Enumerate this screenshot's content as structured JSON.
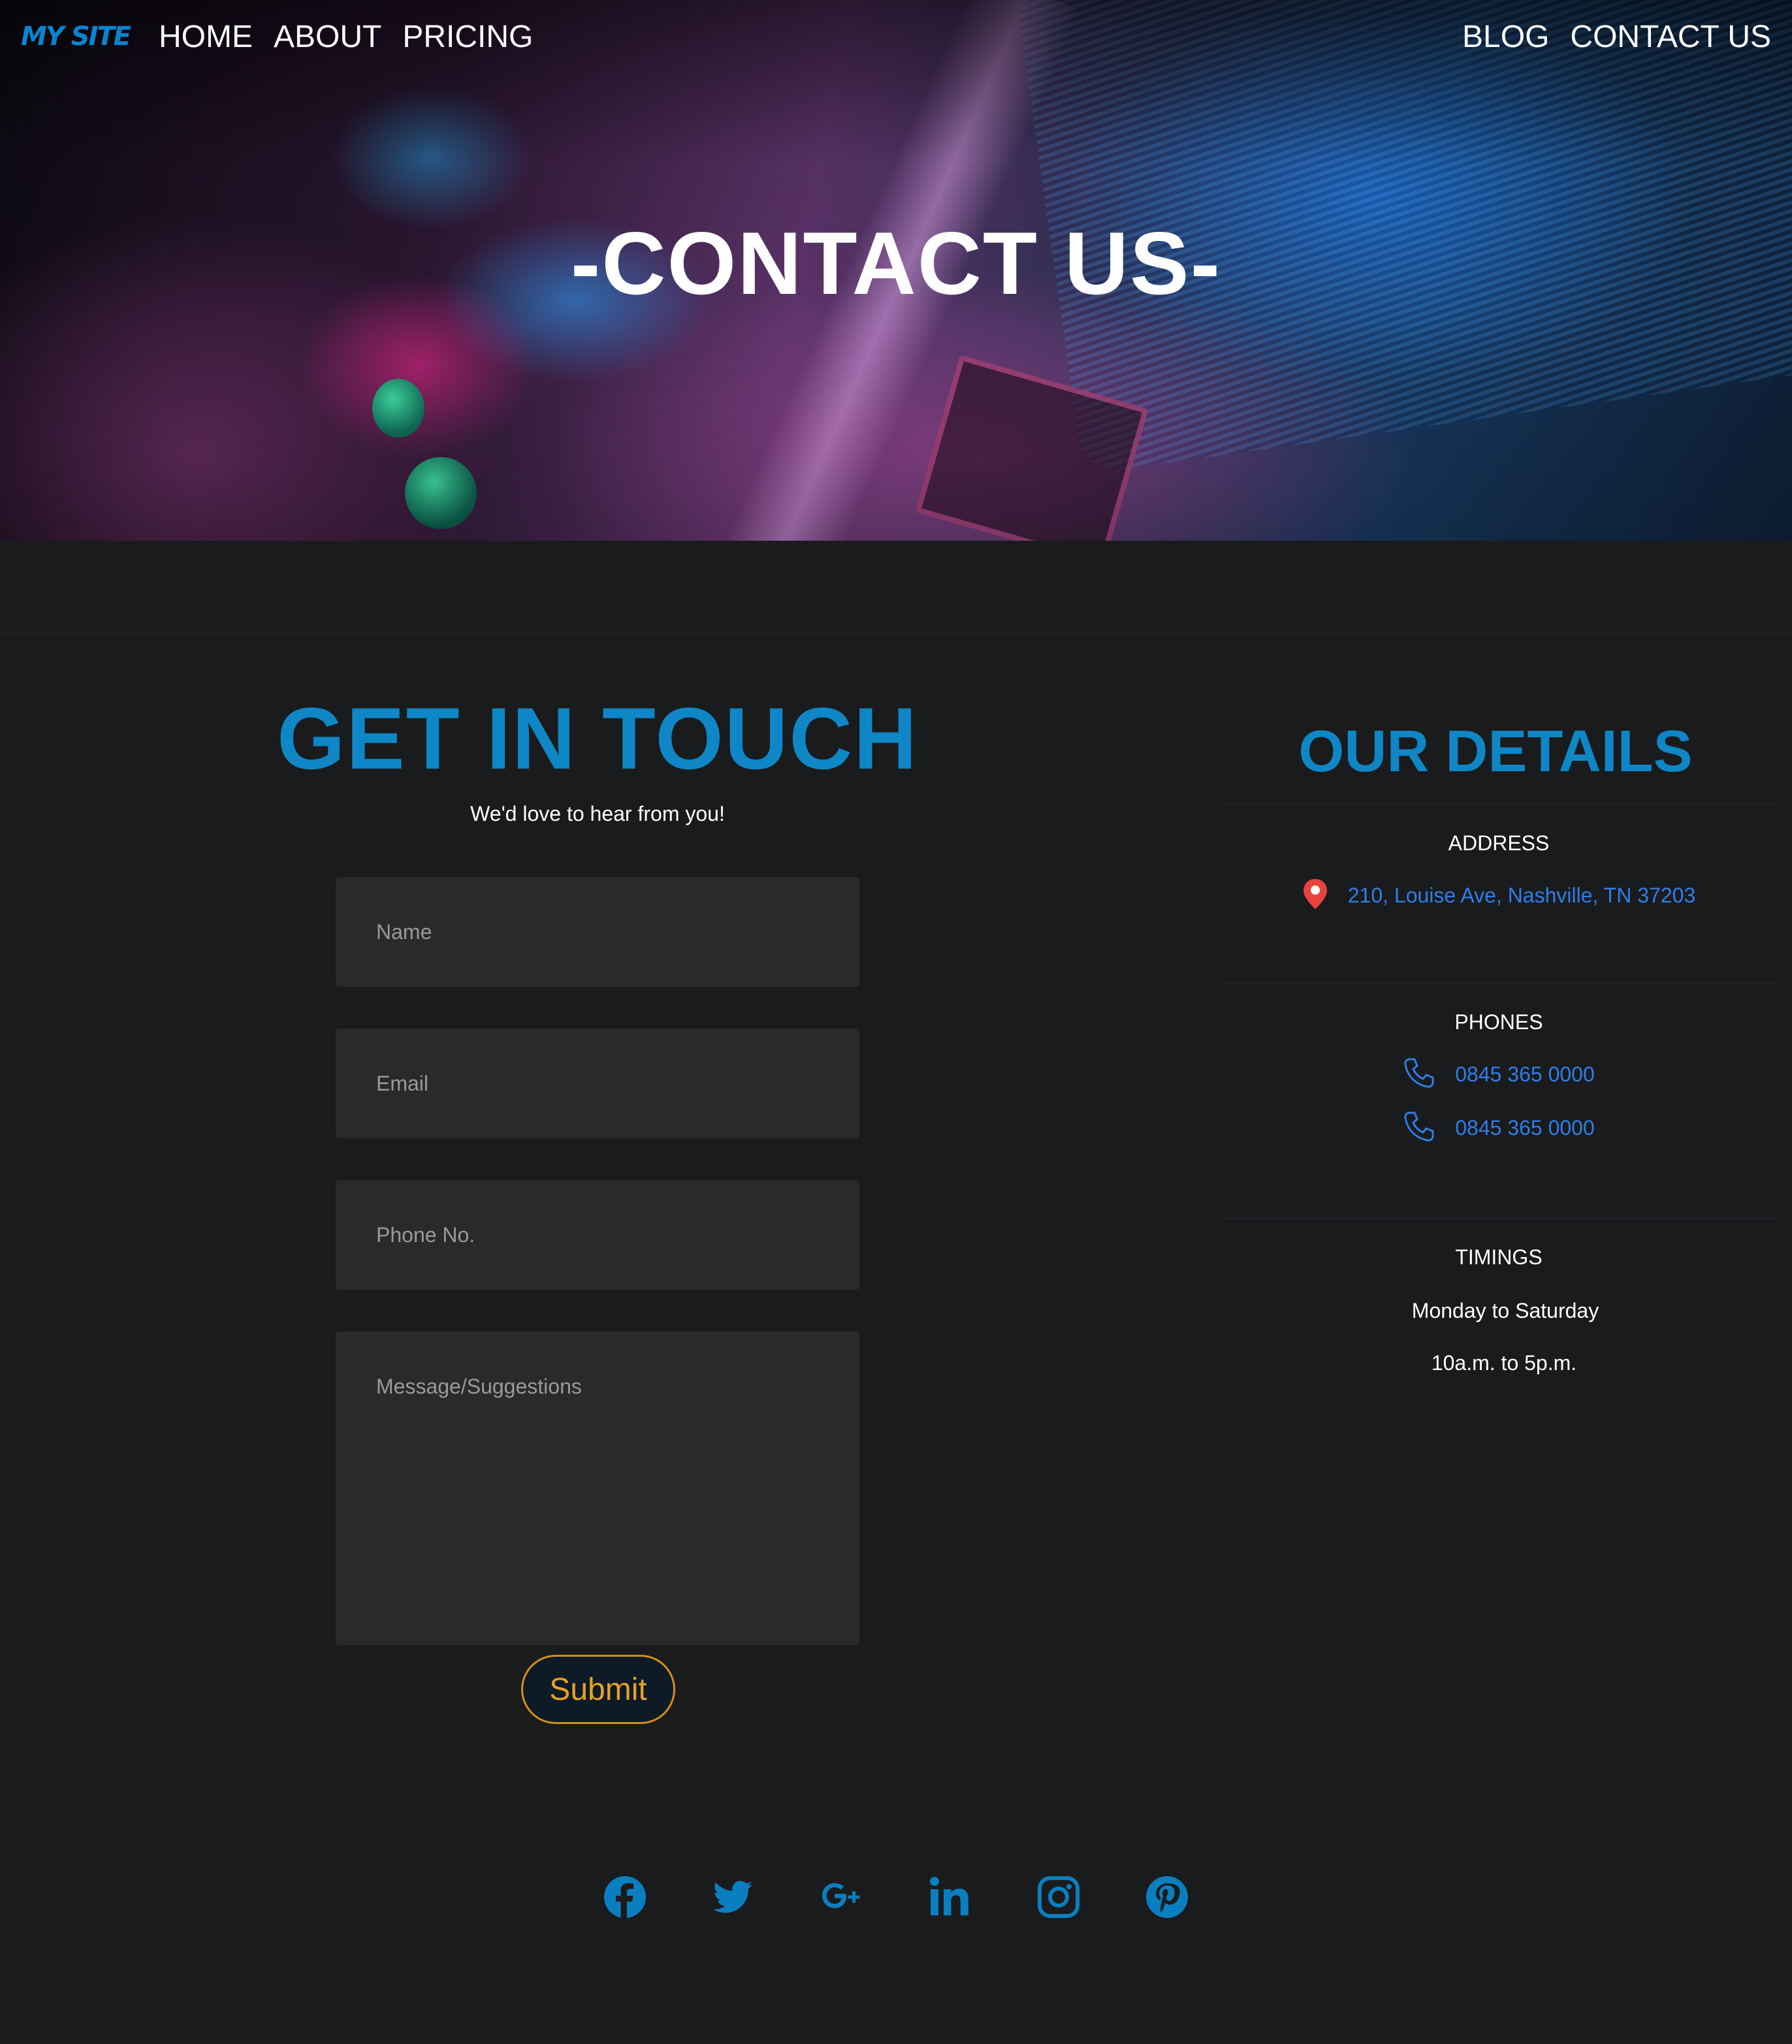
{
  "nav": {
    "brand": "MY SITE",
    "left_links": [
      "HOME",
      "ABOUT",
      "PRICING"
    ],
    "right_links": [
      "BLOG",
      "CONTACT US"
    ]
  },
  "hero": {
    "title": "-CONTACT US-"
  },
  "contact_form": {
    "title": "GET IN TOUCH",
    "subtitle": "We'd love to hear from you!",
    "name_placeholder": "Name",
    "email_placeholder": "Email",
    "phone_placeholder": "Phone No.",
    "message_placeholder": "Message/Suggestions",
    "submit_label": "Submit"
  },
  "details": {
    "title": "OUR DETAILS",
    "address_heading": "ADDRESS",
    "address": "210, Louise Ave, Nashville, TN 37203",
    "phones_heading": "PHONES",
    "phones": [
      "0845 365 0000",
      "0845 365 0000"
    ],
    "timings_heading": "TIMINGS",
    "days": "Monday to Saturday",
    "hours": "10a.m. to 5p.m."
  },
  "social": [
    "facebook-icon",
    "twitter-icon",
    "google-plus-icon",
    "linkedin-icon",
    "instagram-icon",
    "pinterest-icon"
  ],
  "colors": {
    "accent": "#0f86c5",
    "link_blue": "#2f7ee8",
    "submit_border": "#d28f1a",
    "submit_text": "#e5a12a",
    "background": "#1a1b1d",
    "field_bg": "#2a2a2b"
  }
}
